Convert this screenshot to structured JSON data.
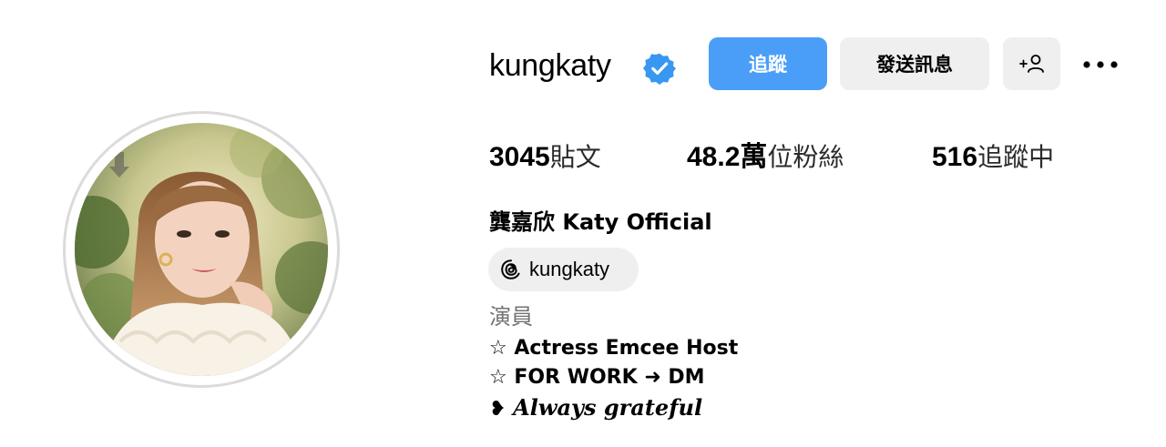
{
  "profile": {
    "username": "kungkaty",
    "verified": true,
    "display_name": "龔嘉欣 Katy Official",
    "threads_handle": "kungkaty",
    "category": "演員",
    "bio_lines": [
      "☆ Actress Emcee Host",
      "☆ FOR WORK ➜ DM",
      "𝑨𝒍𝒘𝒂𝒚𝒔 𝒈𝒓𝒂𝒕𝒆𝒇𝒖𝒍"
    ],
    "bio_heart": "❥"
  },
  "actions": {
    "follow_label": "追蹤",
    "message_label": "發送訊息",
    "suggest_label": "+☹"
  },
  "stats": {
    "posts_count": "3045",
    "posts_label": "貼文",
    "followers_count": "48.2萬",
    "followers_label": "位粉絲",
    "following_count": "516",
    "following_label": "追蹤中"
  },
  "icons": {
    "verified": "verified-badge-icon",
    "more": "more-options-icon",
    "threads": "threads-icon",
    "suggest": "add-person-icon"
  },
  "colors": {
    "follow_button": "#4a9ef8",
    "secondary_button": "#efefef",
    "verified": "#3897f0",
    "muted_text": "#737373"
  }
}
